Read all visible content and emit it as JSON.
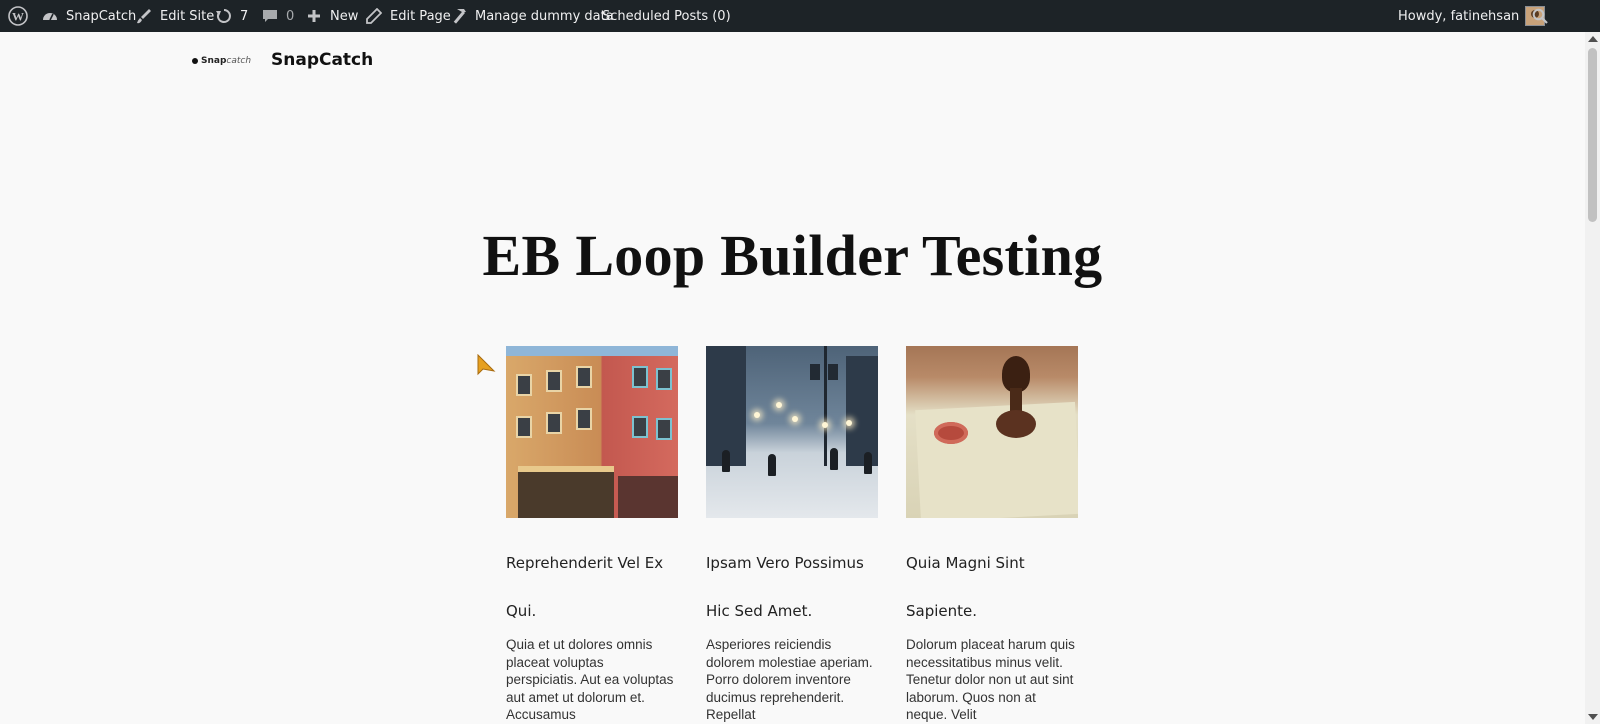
{
  "adminbar": {
    "site_name": "SnapCatch",
    "edit_site": "Edit Site",
    "updates_count": "7",
    "comments_count": "0",
    "new_label": "New",
    "edit_page": "Edit Page",
    "manage_dummy": "Manage dummy data",
    "scheduled_posts": "Scheduled Posts (0)",
    "howdy": "Howdy, fatinehsan"
  },
  "header": {
    "logo_bold": "Snap",
    "logo_italic": "catch",
    "site_title": "SnapCatch"
  },
  "page": {
    "title": "EB Loop Builder Testing"
  },
  "posts": [
    {
      "title": "Reprehenderit Vel Ex",
      "subtitle": "Qui.",
      "excerpt": "Quia et ut dolores omnis placeat voluptas perspiciatis. Aut ea voluptas aut amet ut dolorum et. Accusamus"
    },
    {
      "title": "Ipsam Vero Possimus",
      "subtitle": "Hic Sed Amet.",
      "excerpt": "Asperiores reiciendis dolorem molestiae aperiam. Porro dolorem inventore ducimus reprehenderit. Repellat"
    },
    {
      "title": "Quia Magni Sint",
      "subtitle": "Sapiente.",
      "excerpt": "Dolorum placeat harum quis necessitatibus minus velit. Tenetur dolor non ut aut sint laborum. Quos non at neque. Velit"
    }
  ],
  "icons": {
    "wordpress": "wordpress-logo-icon",
    "dashboard": "dashboard-icon",
    "edit_site": "brush-icon",
    "updates": "updates-icon",
    "comments": "comment-icon",
    "new": "plus-icon",
    "edit_page": "pencil-icon",
    "manage_dummy": "hammer-icon",
    "search": "search-icon"
  },
  "colors": {
    "adminbar_bg": "#1d2327",
    "adminbar_text": "#f0f0f1",
    "page_bg": "#f9f9f9"
  }
}
